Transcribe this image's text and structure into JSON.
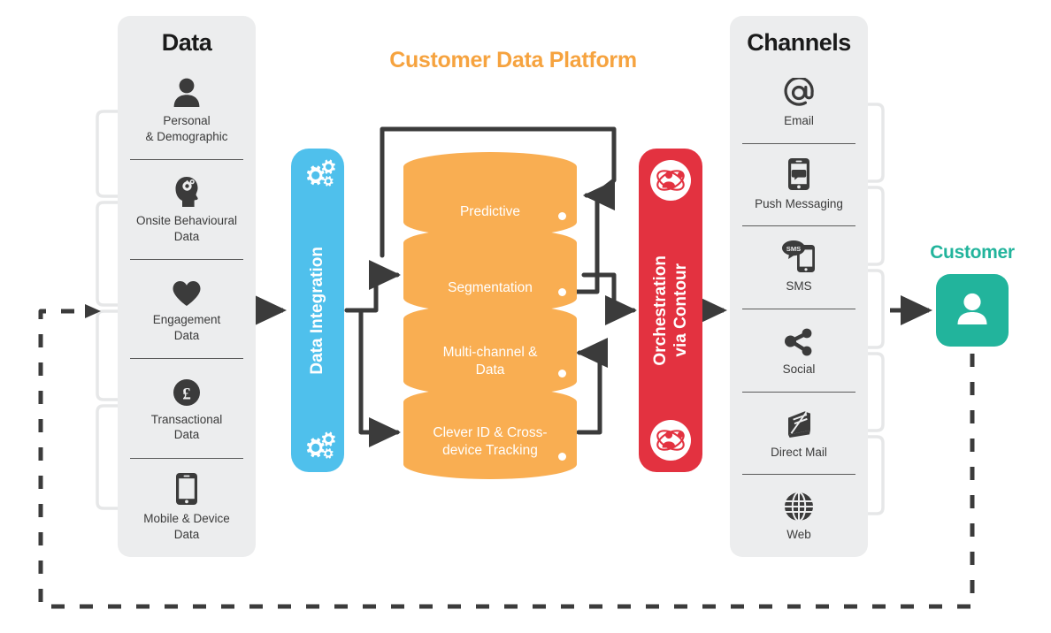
{
  "diagram": {
    "title": "Customer Data Platform",
    "colors": {
      "orange": "#f9ae52",
      "title_orange": "#f6a33f",
      "blue": "#4fc0ec",
      "red": "#e33240",
      "teal": "#22b49c",
      "panel_gray": "#ecedee",
      "arrow_dark": "#3b3b3b",
      "bracket_gray": "#e6e7e8"
    }
  },
  "data_panel": {
    "title": "Data",
    "items": [
      {
        "label": "Personal\n& Demographic",
        "icon": "person-icon"
      },
      {
        "label": "Onsite Behavioural\nData",
        "icon": "head-gear-icon"
      },
      {
        "label": "Engagement\nData",
        "icon": "heart-icon"
      },
      {
        "label": "Transactional\nData",
        "icon": "pound-coin-icon"
      },
      {
        "label": "Mobile & Device\nData",
        "icon": "mobile-phone-icon"
      }
    ]
  },
  "integration_bar": {
    "label": "Data Integration",
    "icon": "gears-icon"
  },
  "platform": {
    "layers": [
      {
        "label": "Predictive"
      },
      {
        "label": "Segmentation"
      },
      {
        "label": "Multi-channel &\nData"
      },
      {
        "label": "Clever ID & Cross-\ndevice Tracking"
      }
    ]
  },
  "orchestration_bar": {
    "label": "Orchestration\nvia Contour",
    "icon": "contour-atom-icon"
  },
  "channels_panel": {
    "title": "Channels",
    "items": [
      {
        "label": "Email",
        "icon": "at-sign-icon"
      },
      {
        "label": "Push Messaging",
        "icon": "push-notification-icon"
      },
      {
        "label": "SMS",
        "icon": "sms-icon"
      },
      {
        "label": "Social",
        "icon": "share-icon"
      },
      {
        "label": "Direct Mail",
        "icon": "mail-booklet-icon"
      },
      {
        "label": "Web",
        "icon": "globe-icon"
      }
    ]
  },
  "customer": {
    "label": "Customer",
    "icon": "customer-person-icon"
  }
}
